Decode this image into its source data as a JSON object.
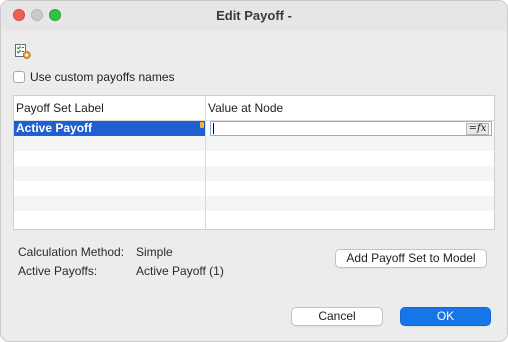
{
  "window": {
    "title": "Edit Payoff -"
  },
  "toolbar": {
    "icon": "checklist-settings-icon"
  },
  "options": {
    "custom_names_label": "Use custom payoffs names",
    "custom_names_checked": false
  },
  "table": {
    "headers": [
      "Payoff Set Label",
      "Value at Node"
    ],
    "rows": [
      {
        "label": "Active Payoff",
        "value": ""
      }
    ],
    "fx_label": "=fx"
  },
  "info": {
    "calc_method_label": "Calculation Method:",
    "calc_method_value": "Simple",
    "active_payoffs_label": "Active Payoffs:",
    "active_payoffs_value": "Active Payoff (1)"
  },
  "buttons": {
    "add_set": "Add Payoff Set to Model",
    "cancel": "Cancel",
    "ok": "OK"
  },
  "colors": {
    "selection": "#1f5fd1",
    "primary_button": "#1676e8",
    "close": "#ee5f58",
    "maximize": "#32c146"
  }
}
